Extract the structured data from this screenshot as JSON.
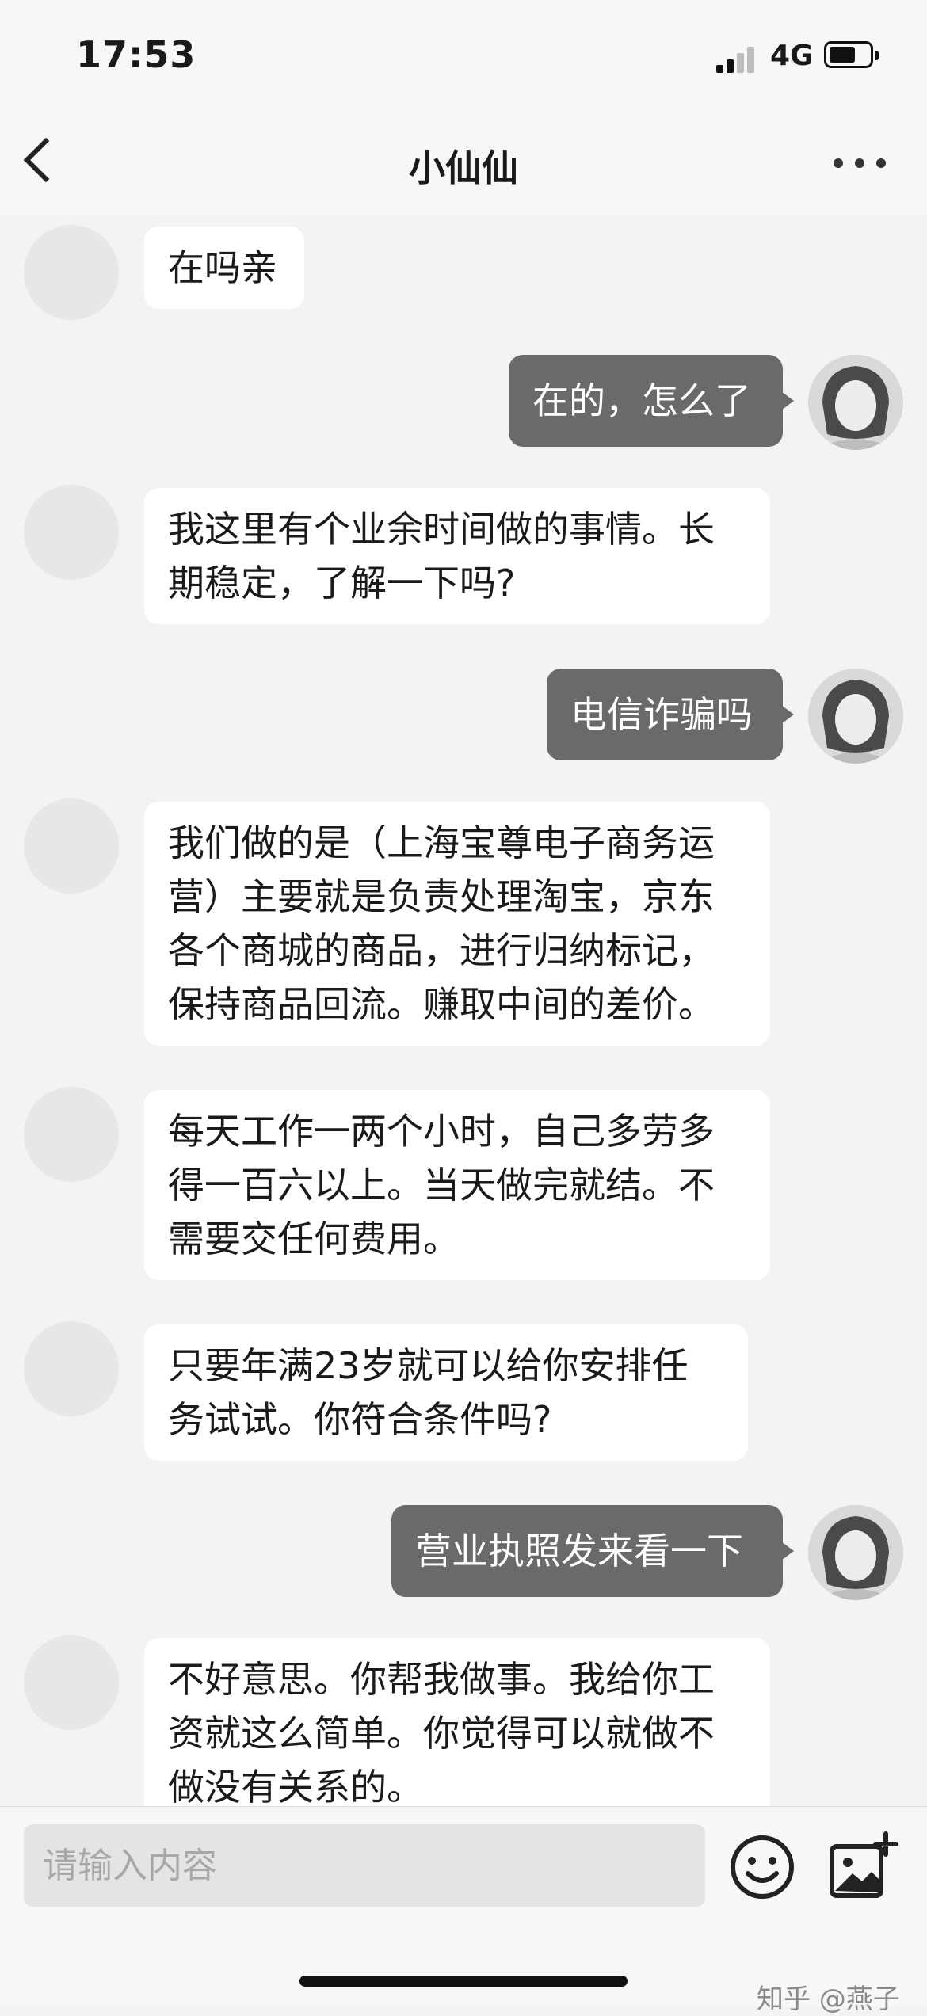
{
  "status": {
    "time": "17:53",
    "network": "4G"
  },
  "nav": {
    "title": "小仙仙"
  },
  "messages": [
    {
      "text": "在吗亲"
    },
    {
      "text": "在的，怎么了"
    },
    {
      "text": "我这里有个业余时间做的事情。长期稳定，了解一下吗?"
    },
    {
      "text": "电信诈骗吗"
    },
    {
      "text": "我们做的是（上海宝尊电子商务运营）主要就是负责处理淘宝，京东各个商城的商品，进行归纳标记，保持商品回流。赚取中间的差价。"
    },
    {
      "text": "每天工作一两个小时，自己多劳多得一百六以上。当天做完就结。不需要交任何费用。"
    },
    {
      "text": "只要年满23岁就可以给你安排任务试试。你符合条件吗?"
    },
    {
      "text": "营业执照发来看一下"
    },
    {
      "text": "不好意思。你帮我做事。我给你工资就这么简单。你觉得可以就做不做没有关系的。"
    }
  ],
  "input": {
    "placeholder": "请输入内容"
  },
  "watermark": "知乎 @燕子",
  "icons": {
    "back": "chevron-left-icon",
    "more": "more-dots-icon",
    "emoji": "emoji-icon",
    "image": "add-image-icon"
  }
}
